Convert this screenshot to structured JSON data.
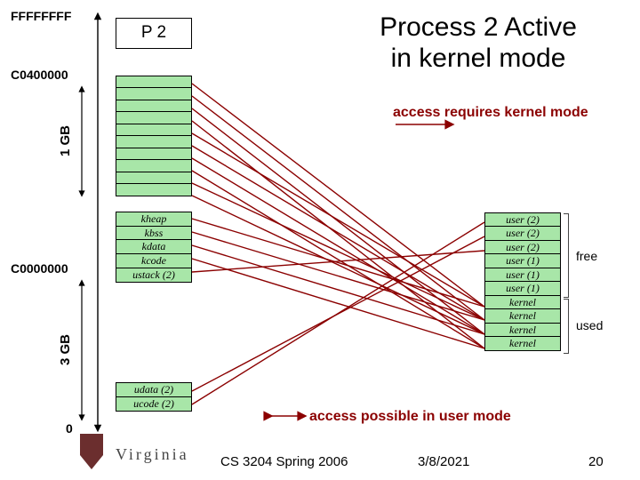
{
  "addresses": {
    "top": "FFFFFFFF",
    "mid1": "C0400000",
    "mid2": "C0000000",
    "bottom": "0"
  },
  "sizes": {
    "upper": "1 GB",
    "lower": "3 GB"
  },
  "proc": {
    "header": "P 2"
  },
  "kernel_rows": [
    "kheap",
    "kbss",
    "kdata",
    "kcode",
    "ustack (2)"
  ],
  "user_rows": [
    "udata (2)",
    "ucode (2)"
  ],
  "title_l1": "Process 2 Active",
  "title_l2": "in kernel mode",
  "legend": {
    "kernel": "access requires kernel mode",
    "user": "access possible in user mode"
  },
  "frames": [
    "user (2)",
    "user (2)",
    "user (2)",
    "user (1)",
    "user (1)",
    "user (1)",
    "kernel",
    "kernel",
    "kernel",
    "kernel"
  ],
  "annot": {
    "free": "free",
    "used": "used"
  },
  "footer": {
    "left": "CS 3204 Spring 2006",
    "mid": "3/8/2021",
    "right": "20"
  },
  "logo_text": "Virginia"
}
